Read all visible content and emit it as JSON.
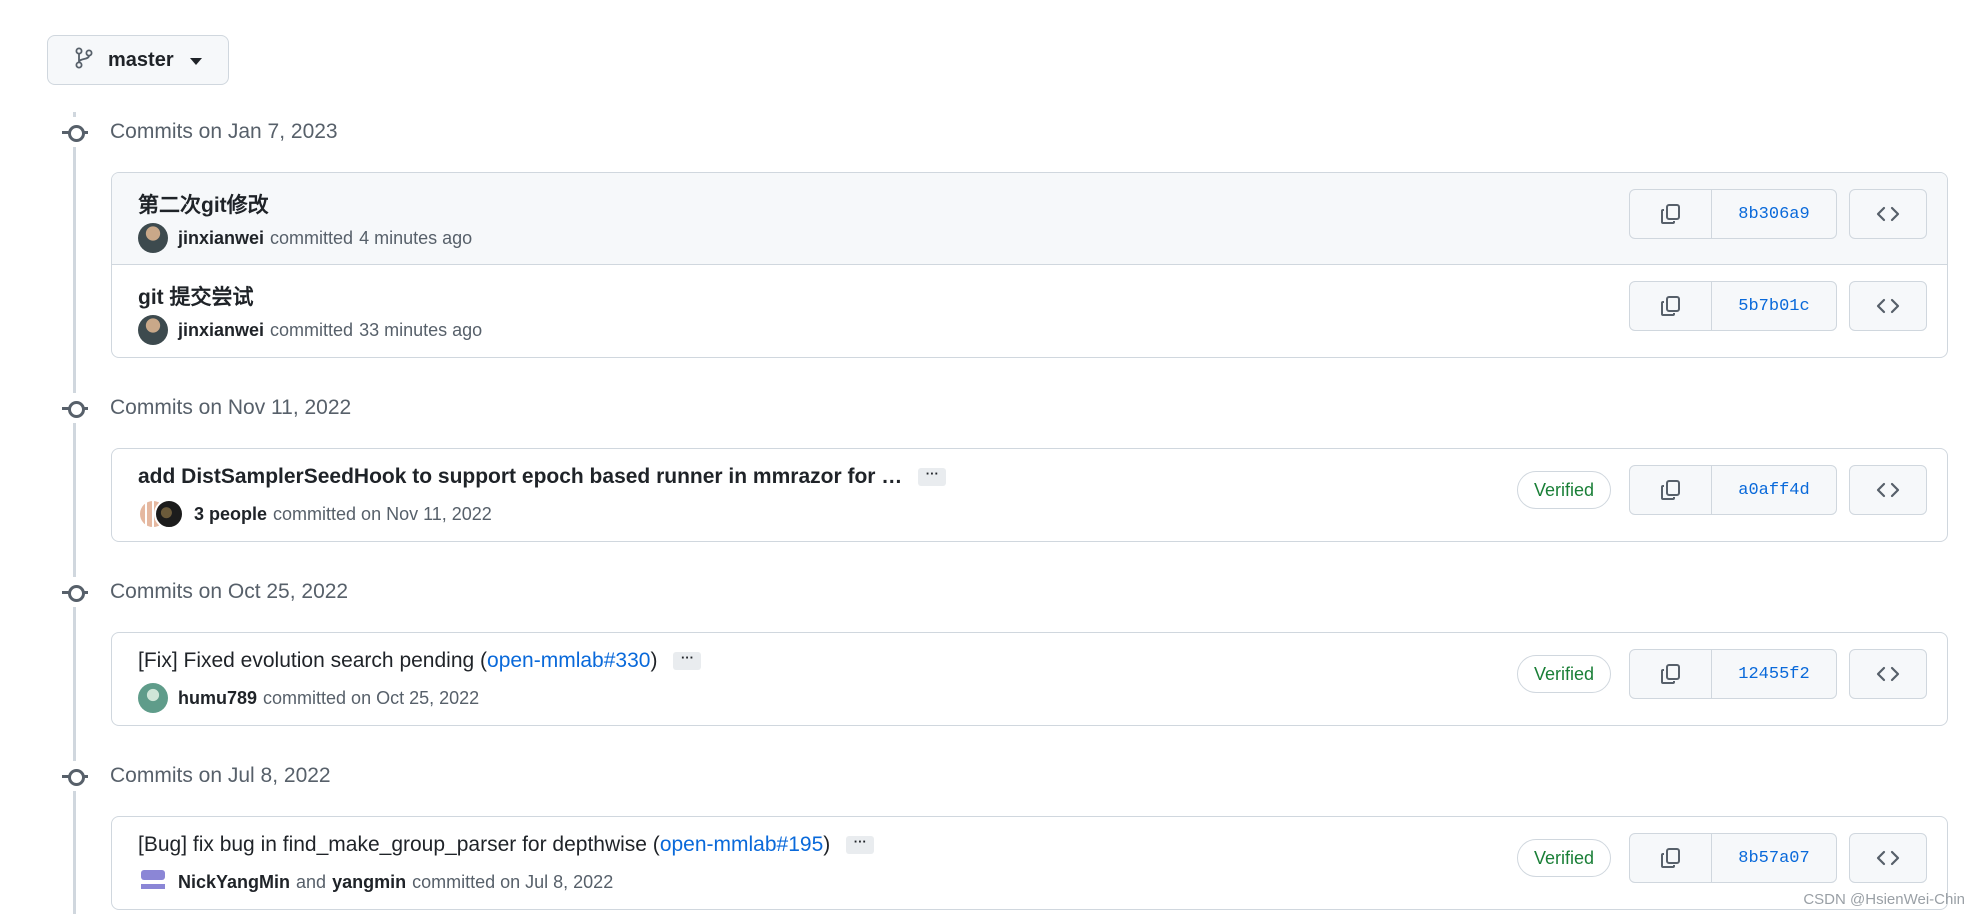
{
  "branch": {
    "name": "master",
    "icon": "git-branch-icon"
  },
  "groups": [
    {
      "title": "Commits on Jan 7, 2023",
      "commits": [
        {
          "message": "第二次git修改",
          "author": "jinxianwei",
          "action": "committed",
          "time": "4 minutes ago",
          "sha": "8b306a9"
        },
        {
          "message": "git 提交尝试",
          "author": "jinxianwei",
          "action": "committed",
          "time": "33 minutes ago",
          "sha": "5b7b01c"
        }
      ]
    },
    {
      "title": "Commits on Nov 11, 2022",
      "commits": [
        {
          "message": "add DistSamplerSeedHook to support epoch based runner in mmrazor for …",
          "ellipsis": "···",
          "author": "3 people",
          "action": "committed on Nov 11, 2022",
          "verified": "Verified",
          "sha": "a0aff4d"
        }
      ]
    },
    {
      "title": "Commits on Oct 25, 2022",
      "commits": [
        {
          "message": "[Fix] Fixed evolution search pending (",
          "link": "open-mmlab#330",
          "close": ")",
          "ellipsis": "···",
          "author": "humu789",
          "action": "committed on Oct 25, 2022",
          "verified": "Verified",
          "sha": "12455f2"
        }
      ]
    },
    {
      "title": "Commits on Jul 8, 2022",
      "commits": [
        {
          "message": "[Bug] fix bug in find_make_group_parser for depthwise (",
          "link": "open-mmlab#195",
          "close": ")",
          "ellipsis": "···",
          "author": "NickYangMin",
          "and": "and",
          "coauthor": "yangmin",
          "action": "committed on Jul 8, 2022",
          "verified": "Verified",
          "sha": "8b57a07"
        }
      ]
    }
  ],
  "watermark": "CSDN @HsienWei-Chin",
  "colors": {
    "accent": "#0969da",
    "verified": "#1a7f37",
    "border": "#d0d7de",
    "muted": "#57606a"
  }
}
